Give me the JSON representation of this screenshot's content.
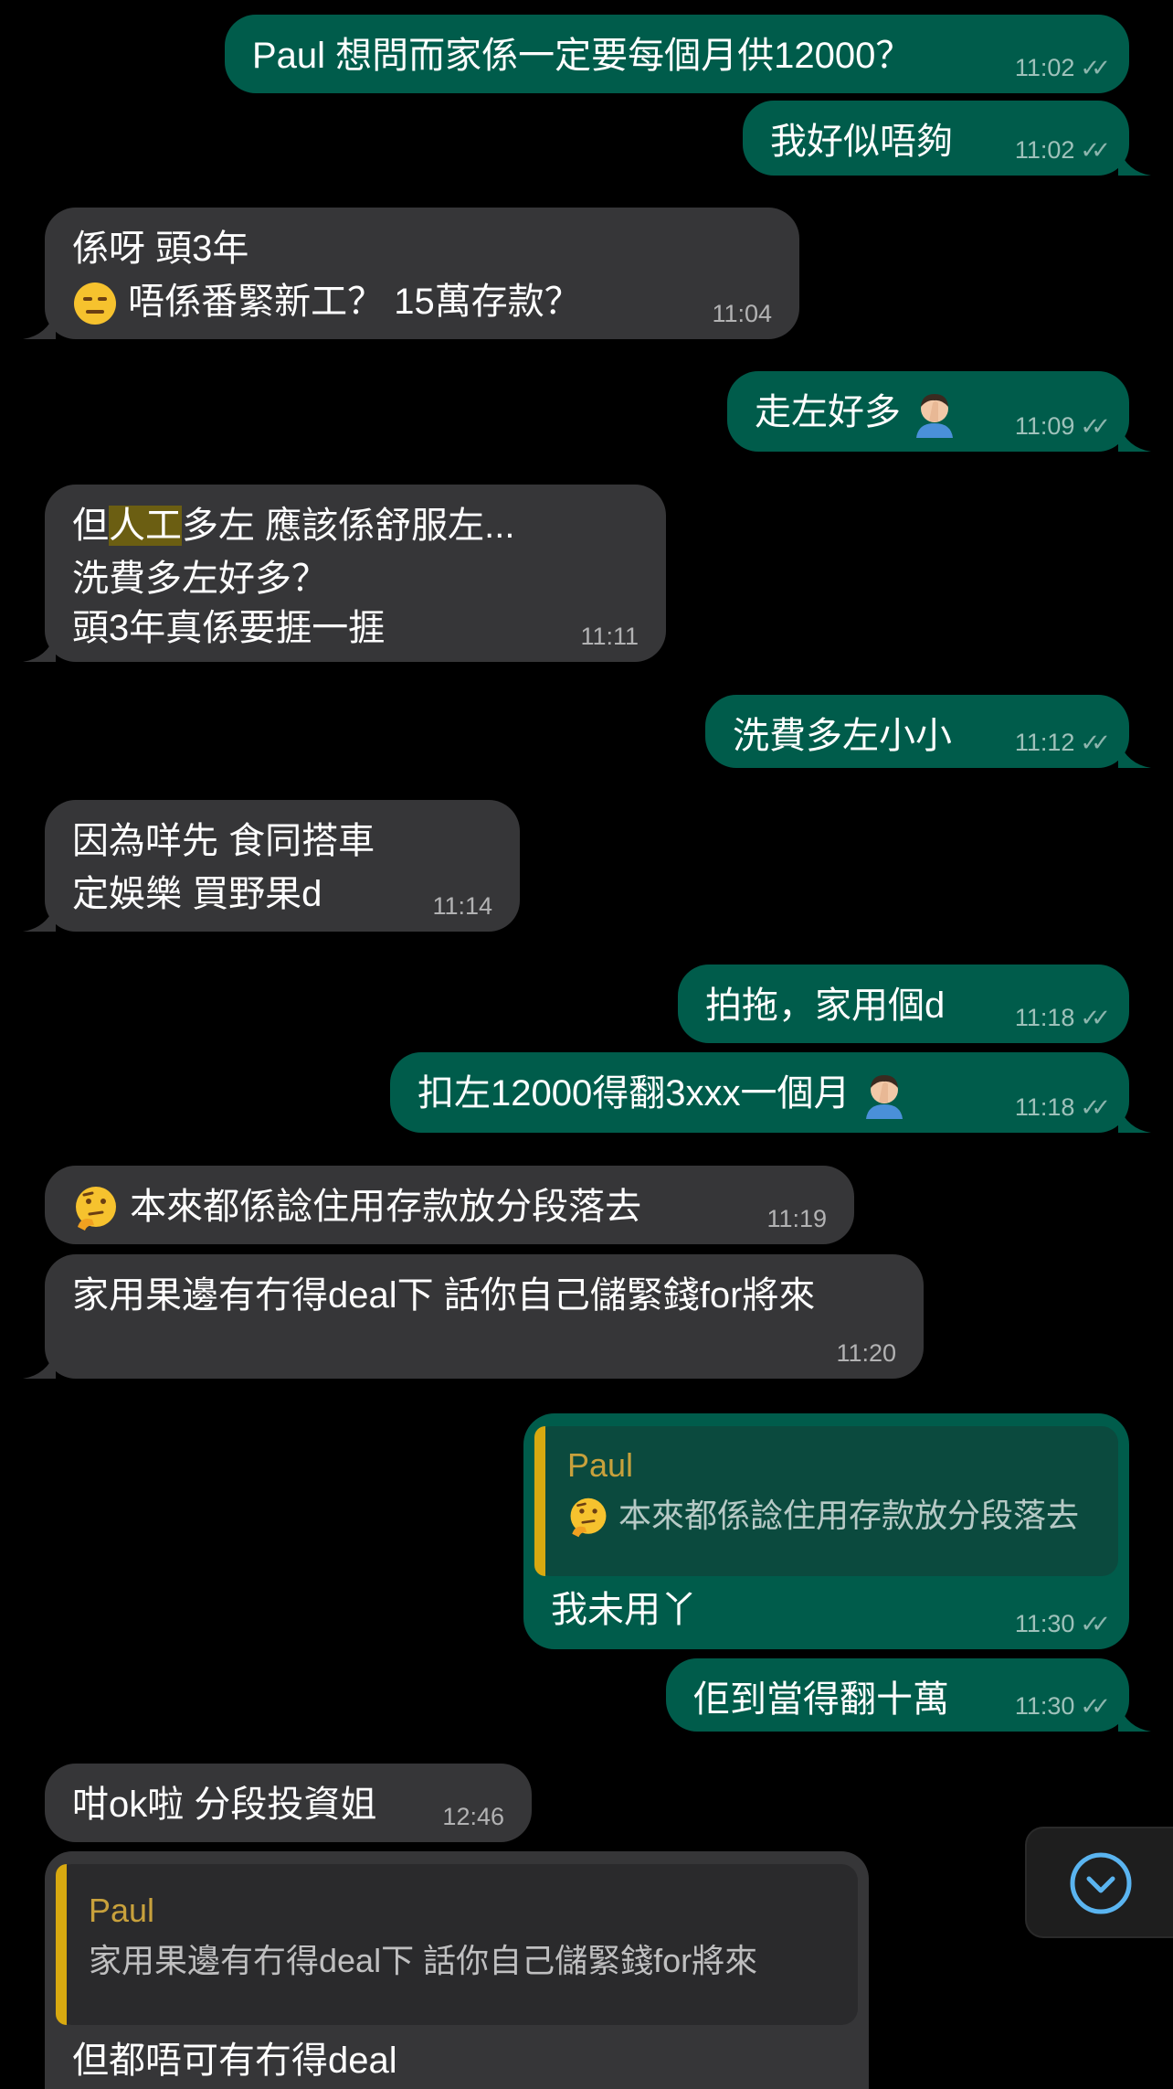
{
  "messages": [
    {
      "id": "m1",
      "dir": "out",
      "text": "Paul 想問而家係一定要每個月供12000？",
      "time": "11:02"
    },
    {
      "id": "m2",
      "dir": "out",
      "text": "我好似唔夠",
      "time": "11:02"
    },
    {
      "id": "m3",
      "dir": "in",
      "line1": "係呀 頭3年",
      "line2": "唔係番緊新工？ 15萬存款？",
      "time": "11:04"
    },
    {
      "id": "m4",
      "dir": "out",
      "text": "走左好多",
      "time": "11:09"
    },
    {
      "id": "m5",
      "dir": "in",
      "line1_a": "但",
      "line1_hl": "人工",
      "line1_b": "多左 應該係舒服左...",
      "line2": "洗費多左好多？",
      "line3": "頭3年真係要捱一捱",
      "time": "11:11"
    },
    {
      "id": "m6",
      "dir": "out",
      "text": "洗費多左小小",
      "time": "11:12"
    },
    {
      "id": "m7",
      "dir": "in",
      "line1": "因為咩先 食同搭車",
      "line2": "定娛樂 買野果d",
      "time": "11:14"
    },
    {
      "id": "m8",
      "dir": "out",
      "text": "拍拖，家用個d",
      "time": "11:18"
    },
    {
      "id": "m9",
      "dir": "out",
      "text": "扣左12000得翻3xxx一個月",
      "time": "11:18"
    },
    {
      "id": "m10",
      "dir": "in",
      "text": "本來都係諗住用存款放分段落去",
      "time": "11:19"
    },
    {
      "id": "m11",
      "dir": "in",
      "text": "家用果邊有冇得deal下 話你自己儲緊錢for將來",
      "time": "11:20"
    },
    {
      "id": "m12",
      "dir": "out",
      "quote_name": "Paul",
      "quote_text": "本來都係諗住用存款放分段落去",
      "text": "我未用丫",
      "time": "11:30"
    },
    {
      "id": "m13",
      "dir": "out",
      "text": "佢到當得翻十萬",
      "time": "11:30"
    },
    {
      "id": "m14",
      "dir": "in",
      "text": "咁ok啦 分段投資姐",
      "time": "12:46"
    },
    {
      "id": "m15",
      "dir": "in",
      "quote_name": "Paul",
      "quote_text": "家用果邊有冇得deal下 話你自己儲緊錢for將來",
      "text": "但都唔可有冇得deal"
    }
  ],
  "icons": {
    "read_receipt": "double-check-icon",
    "emoji_expressionless": "expressionless-face-emoji",
    "emoji_facepalm": "man-facepalming-emoji",
    "emoji_thinking": "thinking-face-emoji",
    "scroll_down": "chevron-down-icon"
  },
  "colors": {
    "outgoing_bubble": "#005c4b",
    "incoming_bubble": "#363638",
    "quote_accent": "#d8a910",
    "scroll_icon": "#5ab4f0"
  }
}
